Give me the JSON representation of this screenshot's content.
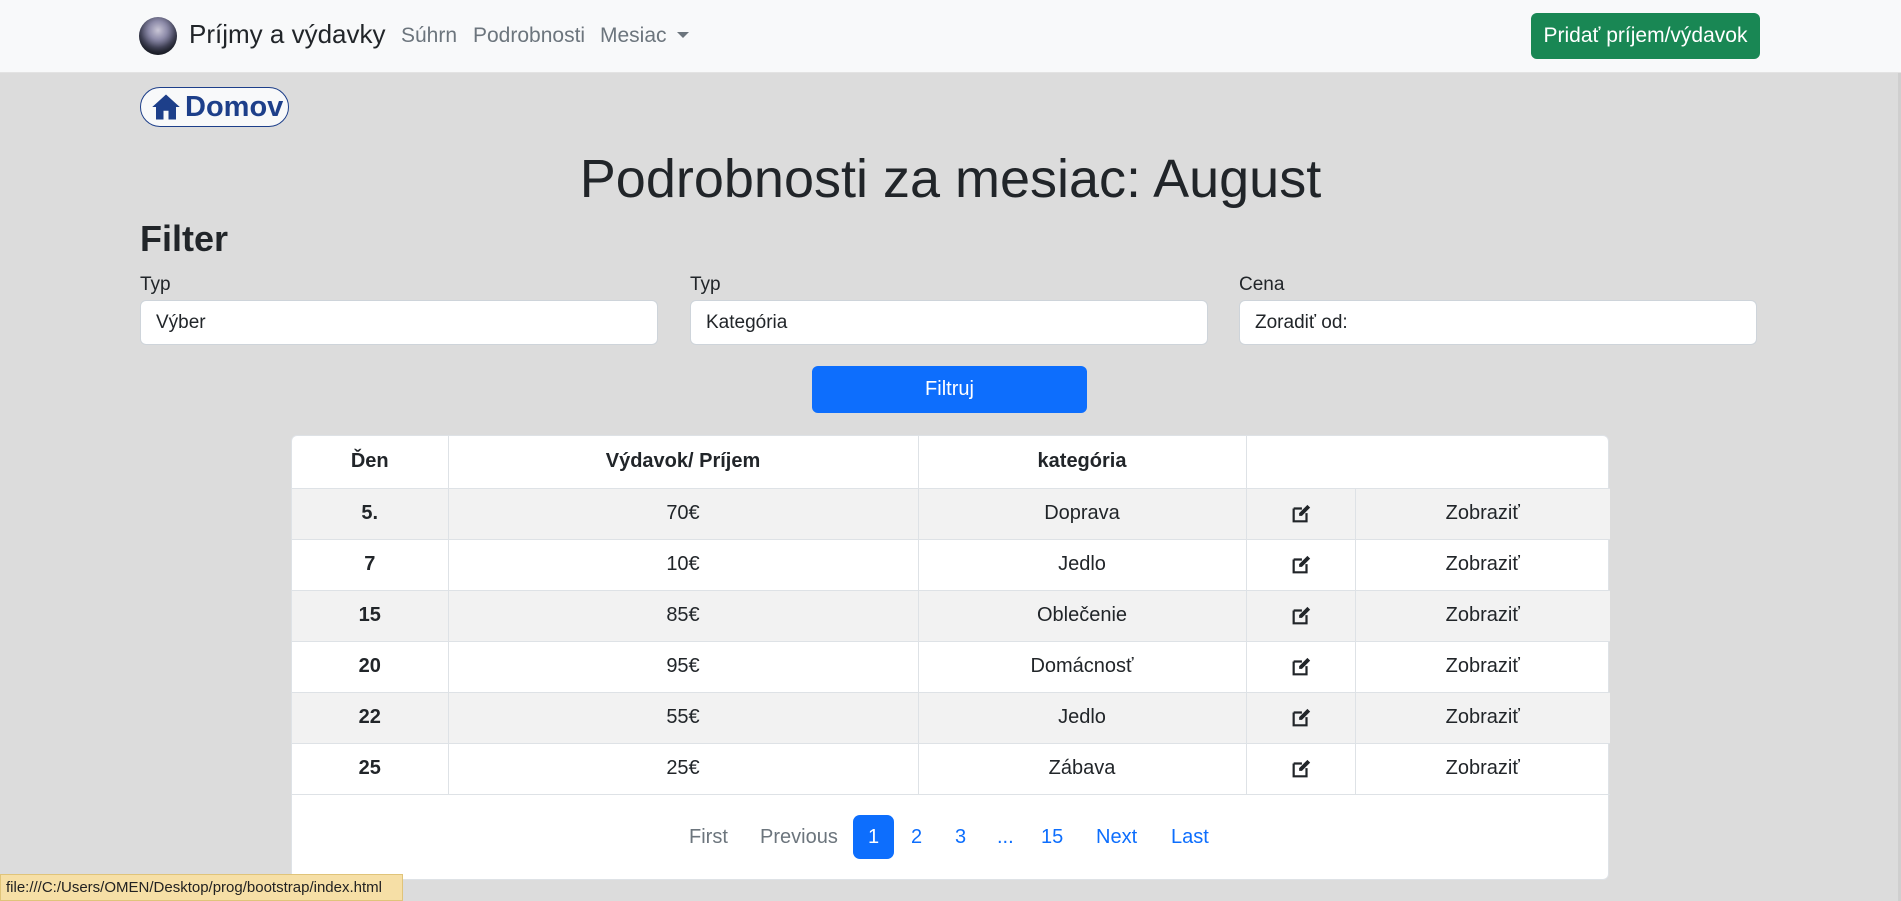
{
  "navbar": {
    "brand": "Príjmy a výdavky",
    "links": [
      "Súhrn",
      "Podrobnosti",
      "Mesiac"
    ],
    "add_button": "Pridať príjem/výdavok"
  },
  "home_button": "Domov",
  "page_title": "Podrobnosti za mesiac: August",
  "filter": {
    "title": "Filter",
    "fields": [
      {
        "label": "Typ",
        "value": "Výber"
      },
      {
        "label": "Typ",
        "value": "Kategória"
      },
      {
        "label": "Cena",
        "value": "Zoradiť od:"
      }
    ],
    "button": "Filtruj"
  },
  "table": {
    "headers": [
      "Ďen",
      "Výdavok/ Príjem",
      "kategória"
    ],
    "rows": [
      {
        "day": "5.",
        "amount": "70€",
        "category": "Doprava",
        "action": "Zobraziť"
      },
      {
        "day": "7",
        "amount": "10€",
        "category": "Jedlo",
        "action": "Zobraziť"
      },
      {
        "day": "15",
        "amount": "85€",
        "category": "Oblečenie",
        "action": "Zobraziť"
      },
      {
        "day": "20",
        "amount": "95€",
        "category": "Domácnosť",
        "action": "Zobraziť"
      },
      {
        "day": "22",
        "amount": "55€",
        "category": "Jedlo",
        "action": "Zobraziť"
      },
      {
        "day": "25",
        "amount": "25€",
        "category": "Zábava",
        "action": "Zobraziť"
      }
    ]
  },
  "pagination": {
    "first": "First",
    "previous": "Previous",
    "pages": [
      "1",
      "2",
      "3",
      "...",
      "15"
    ],
    "next": "Next",
    "last": "Last",
    "active": "1"
  },
  "status_bar": "file:///C:/Users/OMEN/Desktop/prog/bootstrap/index.html"
}
